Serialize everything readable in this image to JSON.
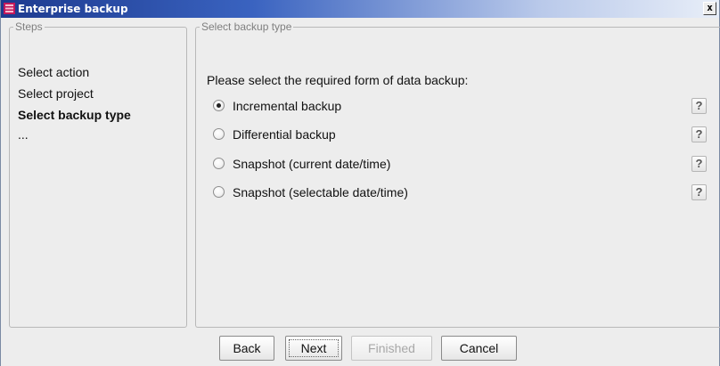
{
  "window": {
    "title": "Enterprise backup",
    "close_label": "x"
  },
  "steps": {
    "legend": "Steps",
    "items": [
      {
        "label": "Select action",
        "active": false
      },
      {
        "label": "Select project",
        "active": false
      },
      {
        "label": "Select backup type",
        "active": true
      },
      {
        "label": "...",
        "active": false
      }
    ]
  },
  "backup_type": {
    "legend": "Select backup type",
    "prompt": "Please select the required form of data backup:",
    "selected": "Incremental backup",
    "options": [
      {
        "label": "Incremental backup",
        "checked": true,
        "help": "?"
      },
      {
        "label": "Differential backup",
        "checked": false,
        "help": "?"
      },
      {
        "label": "Snapshot (current date/time)",
        "checked": false,
        "help": "?"
      },
      {
        "label": "Snapshot (selectable date/time)",
        "checked": false,
        "help": "?"
      }
    ]
  },
  "buttons": {
    "back": "Back",
    "next": "Next",
    "finished": "Finished",
    "cancel": "Cancel"
  },
  "icons": {
    "app": "enterprise-backup-icon",
    "help": "help-question-icon"
  }
}
